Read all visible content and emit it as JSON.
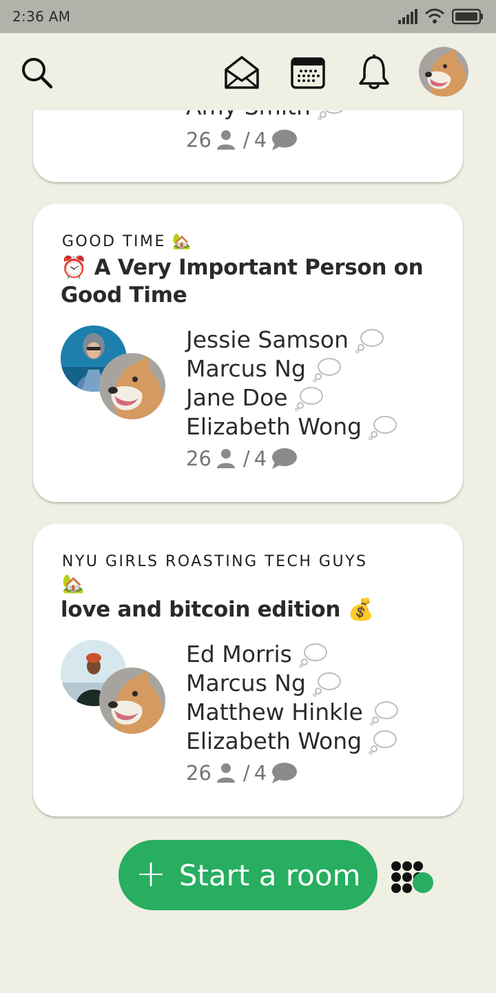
{
  "status_bar": {
    "time": "2:36 AM"
  },
  "colors": {
    "accent_green": "#27ae60",
    "background": "#f0efe4",
    "card": "#ffffff"
  },
  "top_bar": {
    "icons": [
      "search-icon",
      "envelope-icon",
      "calendar-icon",
      "bell-icon",
      "profile-avatar"
    ]
  },
  "rooms": [
    {
      "speakers": [
        "Amy Smith"
      ],
      "listeners": "26",
      "separator": "/",
      "messages": "4"
    },
    {
      "club": "GOOD TIME 🏡",
      "title": "⏰ A Very Important Person on Good Time",
      "speakers": [
        "Jessie Samson",
        "Marcus Ng",
        "Jane Doe",
        "Elizabeth Wong"
      ],
      "listeners": "26",
      "separator": "/",
      "messages": "4"
    },
    {
      "club": "NYU GIRLS ROASTING TECH GUYS",
      "club_emoji": "🏡",
      "title": "love and bitcoin edition 💰",
      "speakers": [
        "Ed Morris",
        "Marcus Ng",
        "Matthew Hinkle",
        "Elizabeth Wong"
      ],
      "listeners": "26",
      "separator": "/",
      "messages": "4"
    }
  ],
  "actions": {
    "start_room_label": "Start a room"
  }
}
